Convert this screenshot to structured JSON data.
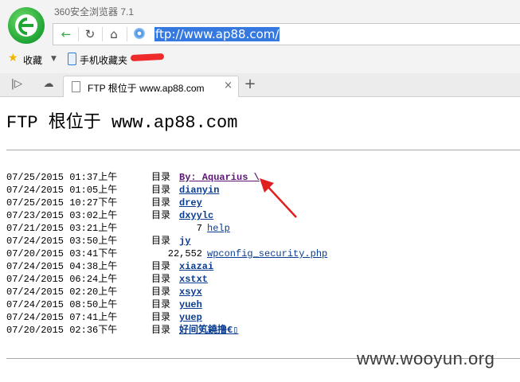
{
  "browser": {
    "app_title": "360安全浏览器 7.1",
    "url": "ftp://www.ap88.com/",
    "bookmarks": {
      "favorites_label": "收藏",
      "mobile_label": "手机收藏夹"
    },
    "tab": {
      "title": "FTP 根位于 www.ap88.com"
    }
  },
  "page": {
    "heading": "FTP 根位于 www.ap88.com",
    "entries": [
      {
        "date": "07/25/2015 01:37上午",
        "kind": "目录",
        "size": "",
        "name": "By: Aquarius \\",
        "is_dir": true,
        "visited": true
      },
      {
        "date": "07/24/2015 01:05上午",
        "kind": "目录",
        "size": "",
        "name": "dianyin",
        "is_dir": true,
        "visited": false
      },
      {
        "date": "07/25/2015 10:27下午",
        "kind": "目录",
        "size": "",
        "name": "drey",
        "is_dir": true,
        "visited": false
      },
      {
        "date": "07/23/2015 03:02上午",
        "kind": "目录",
        "size": "",
        "name": "dxyylc",
        "is_dir": true,
        "visited": false
      },
      {
        "date": "07/21/2015 03:21上午",
        "kind": "",
        "size": "7",
        "name": "help",
        "is_dir": false,
        "visited": false
      },
      {
        "date": "07/24/2015 03:50上午",
        "kind": "目录",
        "size": "",
        "name": "jy",
        "is_dir": true,
        "visited": false
      },
      {
        "date": "07/20/2015 03:41下午",
        "kind": "",
        "size": "22,552",
        "name": "wpconfig_security.php",
        "is_dir": false,
        "visited": false
      },
      {
        "date": "07/24/2015 04:38上午",
        "kind": "目录",
        "size": "",
        "name": "xiazai",
        "is_dir": true,
        "visited": false
      },
      {
        "date": "07/24/2015 06:24上午",
        "kind": "目录",
        "size": "",
        "name": "xstxt",
        "is_dir": true,
        "visited": false
      },
      {
        "date": "07/24/2015 02:20上午",
        "kind": "目录",
        "size": "",
        "name": "xsyx",
        "is_dir": true,
        "visited": false
      },
      {
        "date": "07/24/2015 08:50上午",
        "kind": "目录",
        "size": "",
        "name": "yueh",
        "is_dir": true,
        "visited": false
      },
      {
        "date": "07/24/2015 07:41上午",
        "kind": "目录",
        "size": "",
        "name": "yuep",
        "is_dir": true,
        "visited": false
      },
      {
        "date": "07/20/2015 02:36下午",
        "kind": "目录",
        "size": "",
        "name": "好间笂鐃撸€▯",
        "is_dir": true,
        "visited": false
      }
    ]
  },
  "watermark": "www.wooyun.org",
  "colors": {
    "link": "#0a3d91",
    "visited_link": "#5a1670",
    "url_highlight": "#3478e0",
    "annotation_arrow": "#e02020",
    "logo_green": "#1ea534"
  }
}
